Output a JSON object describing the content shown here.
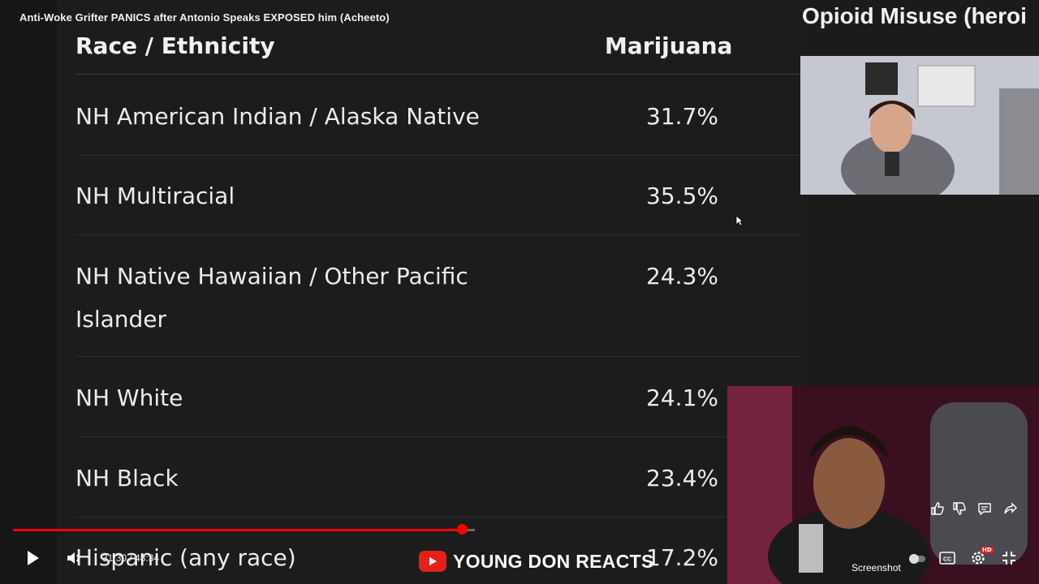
{
  "video": {
    "title": "Anti-Woke Grifter PANICS after Antonio Speaks EXPOSED him (Acheeto)",
    "side_title": "Opioid Misuse (heroi",
    "time_display": "31:30 / 48:34",
    "progress_fraction": 0.972,
    "brand": "YOUNG DON REACTS",
    "screenshot_label": "Screenshot",
    "hd_badge": "HD"
  },
  "table": {
    "headers": [
      "Race / Ethnicity",
      "Marijuana"
    ],
    "rows": [
      {
        "label": "NH American Indian / Alaska Native",
        "value": "31.7%"
      },
      {
        "label": "NH Multiracial",
        "value": "35.5%"
      },
      {
        "label": "NH Native Hawaiian / Other Pacific Islander",
        "value": "24.3%"
      },
      {
        "label": "NH White",
        "value": "24.1%"
      },
      {
        "label": "NH Black",
        "value": "23.4%"
      },
      {
        "label": "Hispanic (any race)",
        "value": "17.2%"
      }
    ]
  },
  "icons": {
    "play": "play-icon",
    "volume": "volume-icon",
    "like": "thumbs-up-icon",
    "dislike": "thumbs-down-icon",
    "comment": "comment-icon",
    "share": "share-icon",
    "toggle": "autoplay-toggle-icon",
    "captions": "captions-icon",
    "settings": "gear-icon",
    "exit_fullscreen": "exit-fullscreen-icon",
    "cursor": "mouse-cursor-icon"
  },
  "colors": {
    "progress": "#ff0000",
    "brand_logo": "#e62117",
    "background": "#1c1c1c"
  }
}
